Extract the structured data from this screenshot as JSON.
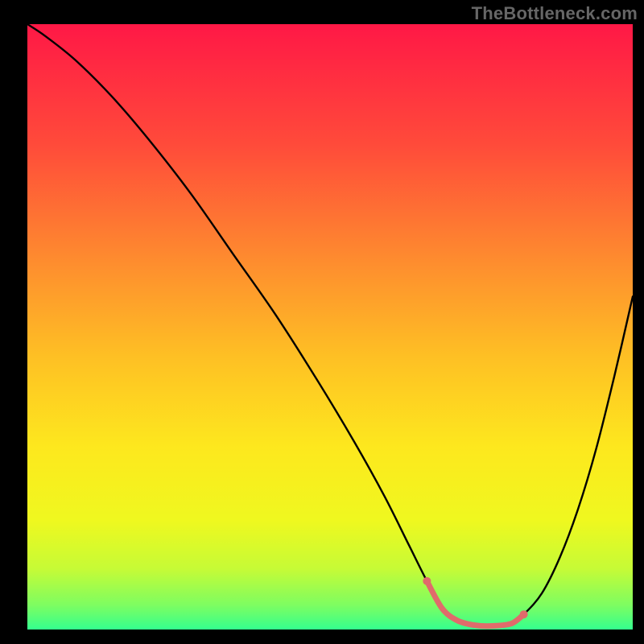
{
  "watermark": "TheBottleneck.com",
  "chart_data": {
    "type": "line",
    "title": "",
    "xlabel": "",
    "ylabel": "",
    "xlim": [
      0,
      100
    ],
    "ylim": [
      0,
      100
    ],
    "grid": false,
    "legend": false,
    "background": {
      "type": "vertical-gradient",
      "stops": [
        {
          "offset": 0.0,
          "color": "#ff1846"
        },
        {
          "offset": 0.2,
          "color": "#ff4b3a"
        },
        {
          "offset": 0.4,
          "color": "#fe8f2e"
        },
        {
          "offset": 0.55,
          "color": "#fec024"
        },
        {
          "offset": 0.7,
          "color": "#fde81e"
        },
        {
          "offset": 0.82,
          "color": "#eff81f"
        },
        {
          "offset": 0.9,
          "color": "#c6fb36"
        },
        {
          "offset": 0.96,
          "color": "#7dfd61"
        },
        {
          "offset": 1.0,
          "color": "#34ff8e"
        }
      ]
    },
    "series": [
      {
        "name": "bottleneck-curve",
        "stroke": "#000000",
        "stroke_width": 2.4,
        "x": [
          0,
          3,
          8,
          14,
          20,
          27,
          34,
          41,
          48,
          54,
          59,
          63,
          66,
          68.5,
          71,
          74,
          77,
          80,
          82,
          85,
          88,
          91,
          94,
          97,
          100
        ],
        "values": [
          100,
          98,
          94,
          88,
          81,
          72,
          62,
          52,
          41,
          31,
          22,
          14,
          8,
          3.5,
          1.5,
          0.7,
          0.6,
          1.0,
          2.5,
          6,
          12,
          20,
          30,
          42,
          55
        ]
      }
    ],
    "highlight_segment": {
      "name": "optimal-region",
      "stroke": "#e06b6b",
      "stroke_width": 7,
      "x": [
        66,
        68.5,
        71,
        74,
        77,
        80,
        82
      ],
      "values": [
        8,
        3.5,
        1.5,
        0.7,
        0.6,
        1.0,
        2.5
      ],
      "endpoints": [
        {
          "x": 66,
          "y": 8
        },
        {
          "x": 82,
          "y": 2.5
        }
      ]
    }
  }
}
